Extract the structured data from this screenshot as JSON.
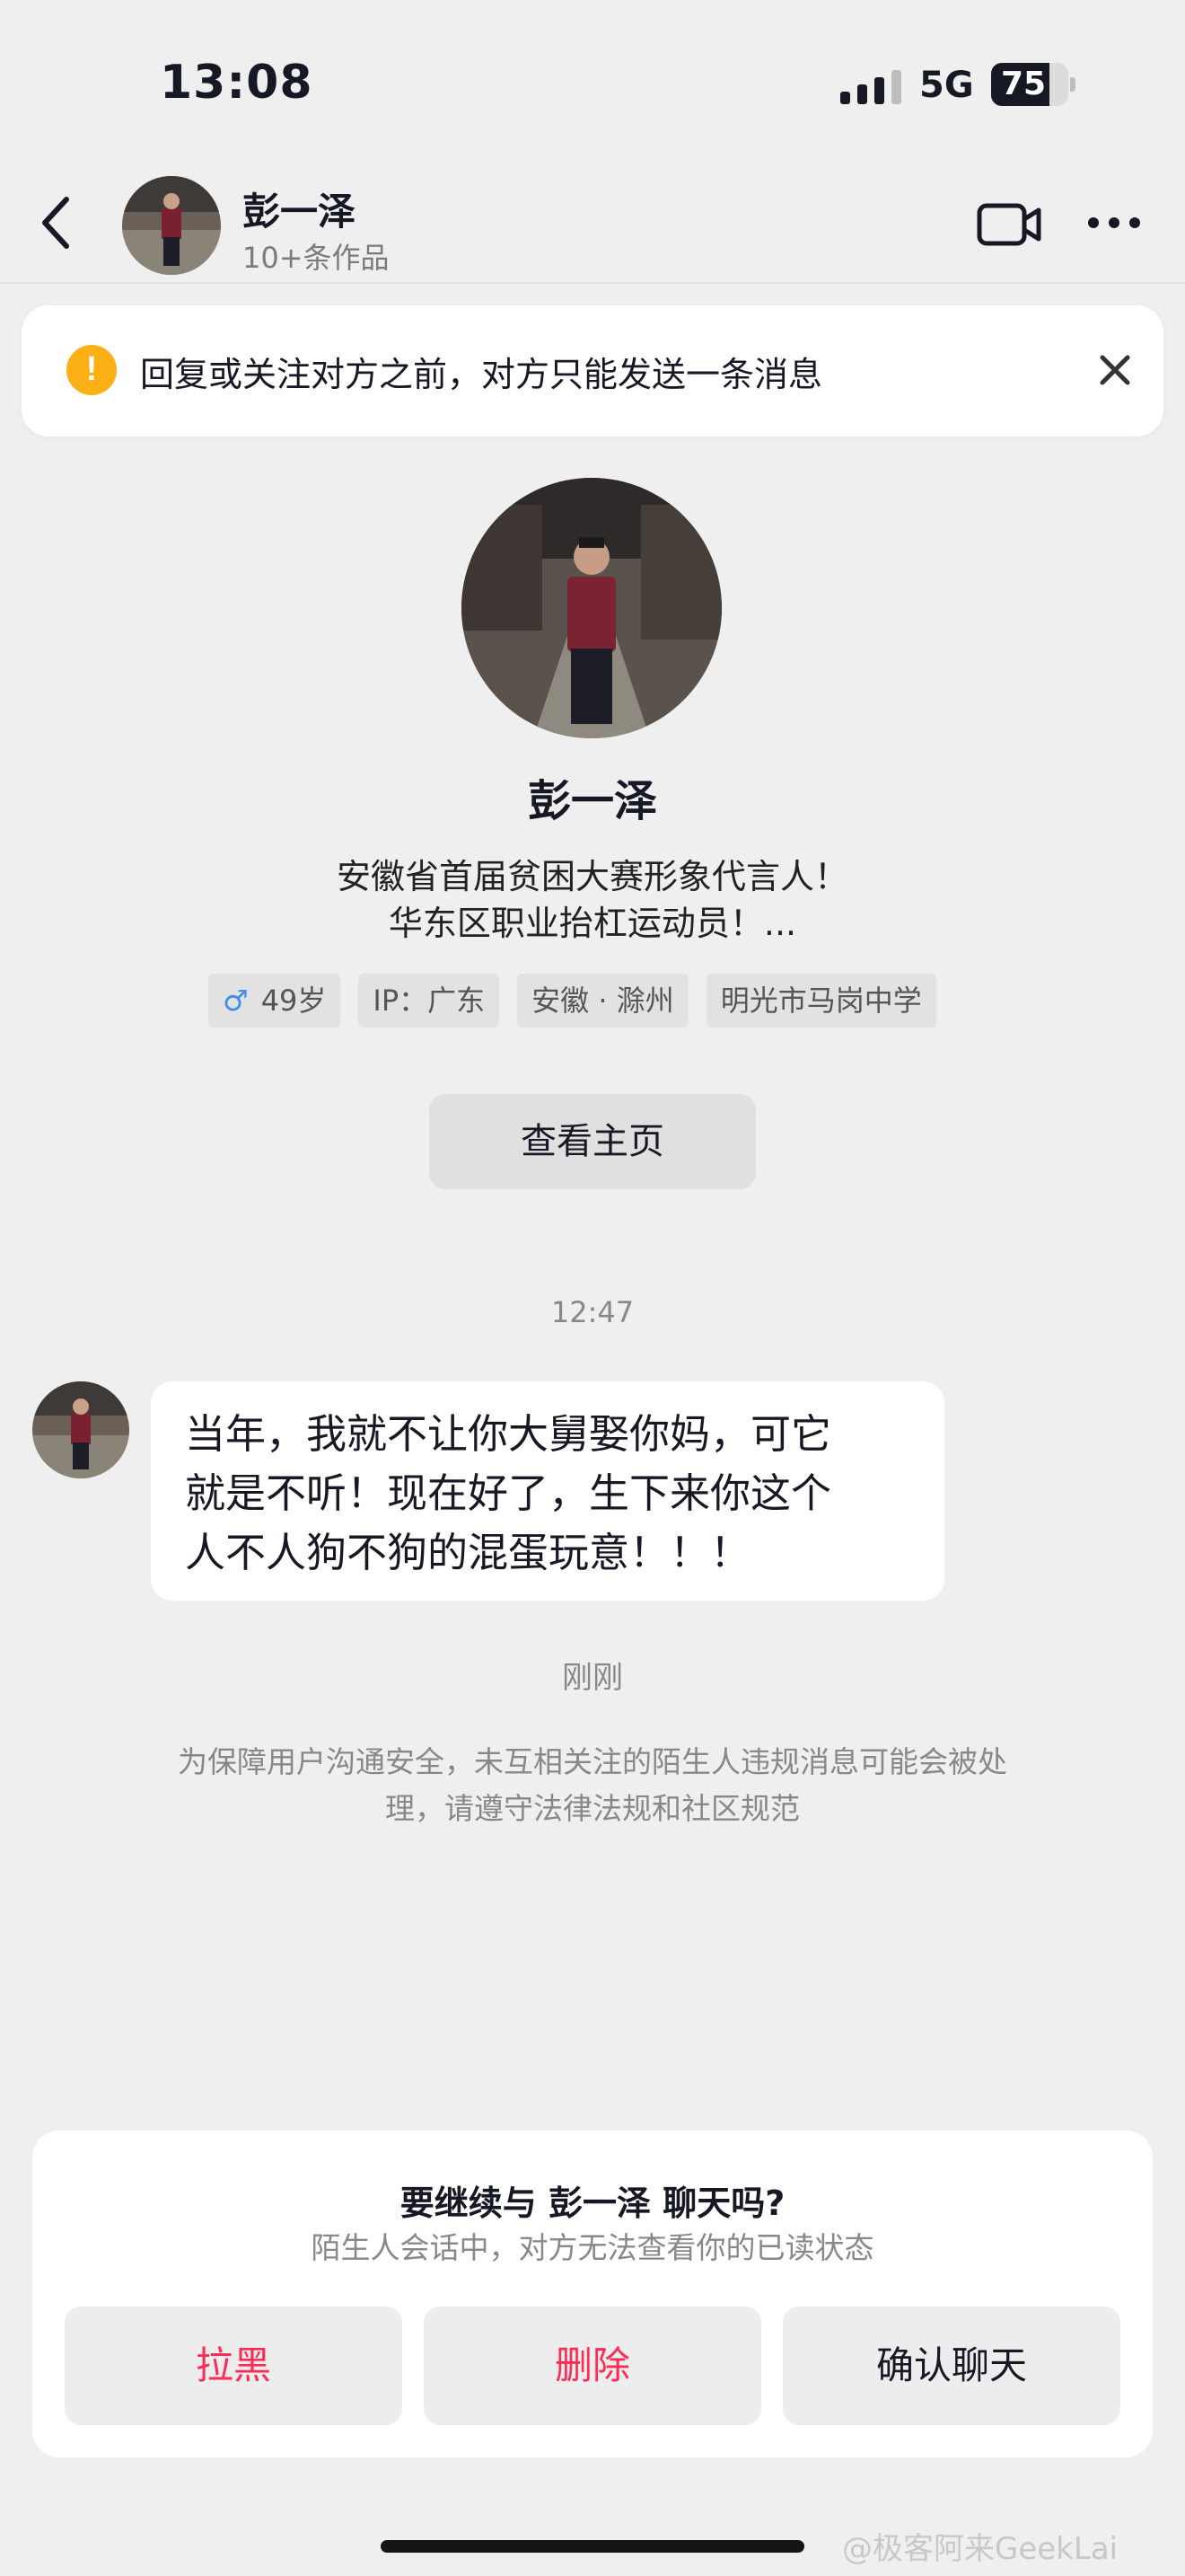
{
  "status_bar": {
    "time": "13:08",
    "network": "5G",
    "battery": "75",
    "battery_level": 0.75
  },
  "nav": {
    "name": "彭一泽",
    "subtitle": "10+条作品"
  },
  "notice": {
    "text": "回复或关注对方之前，对方只能发送一条消息"
  },
  "profile": {
    "name": "彭一泽",
    "bio_line1": "安徽省首届贫困大赛形象代言人！",
    "bio_line2": "华东区职业抬杠运动员！...",
    "tags": {
      "gender_symbol": "♂",
      "age": "49岁",
      "ip": "IP：广东",
      "location": "安徽 · 滁州",
      "school": "明光市马岗中学"
    },
    "view_home_label": "查看主页"
  },
  "chat": {
    "time_first": "12:47",
    "message_line1": "当年，我就不让你大舅娶你妈，可它",
    "message_line2": "就是不听！现在好了，生下来你这个",
    "message_line3": "人不人狗不狗的混蛋玩意！！！",
    "time_second": "刚刚",
    "safety_line1": "为保障用户沟通安全，未互相关注的陌生人违规消息可能会被处",
    "safety_line2": "理，请遵守法律法规和社区规范"
  },
  "sheet": {
    "title": "要继续与 彭一泽 聊天吗?",
    "subtitle": "陌生人会话中，对方无法查看你的已读状态",
    "block_label": "拉黑",
    "delete_label": "删除",
    "confirm_label": "确认聊天"
  },
  "watermark": "@极客阿来GeekLai",
  "colors": {
    "accent_red": "#fe2c55",
    "warning": "#fbb015",
    "male": "#3f8de8"
  }
}
